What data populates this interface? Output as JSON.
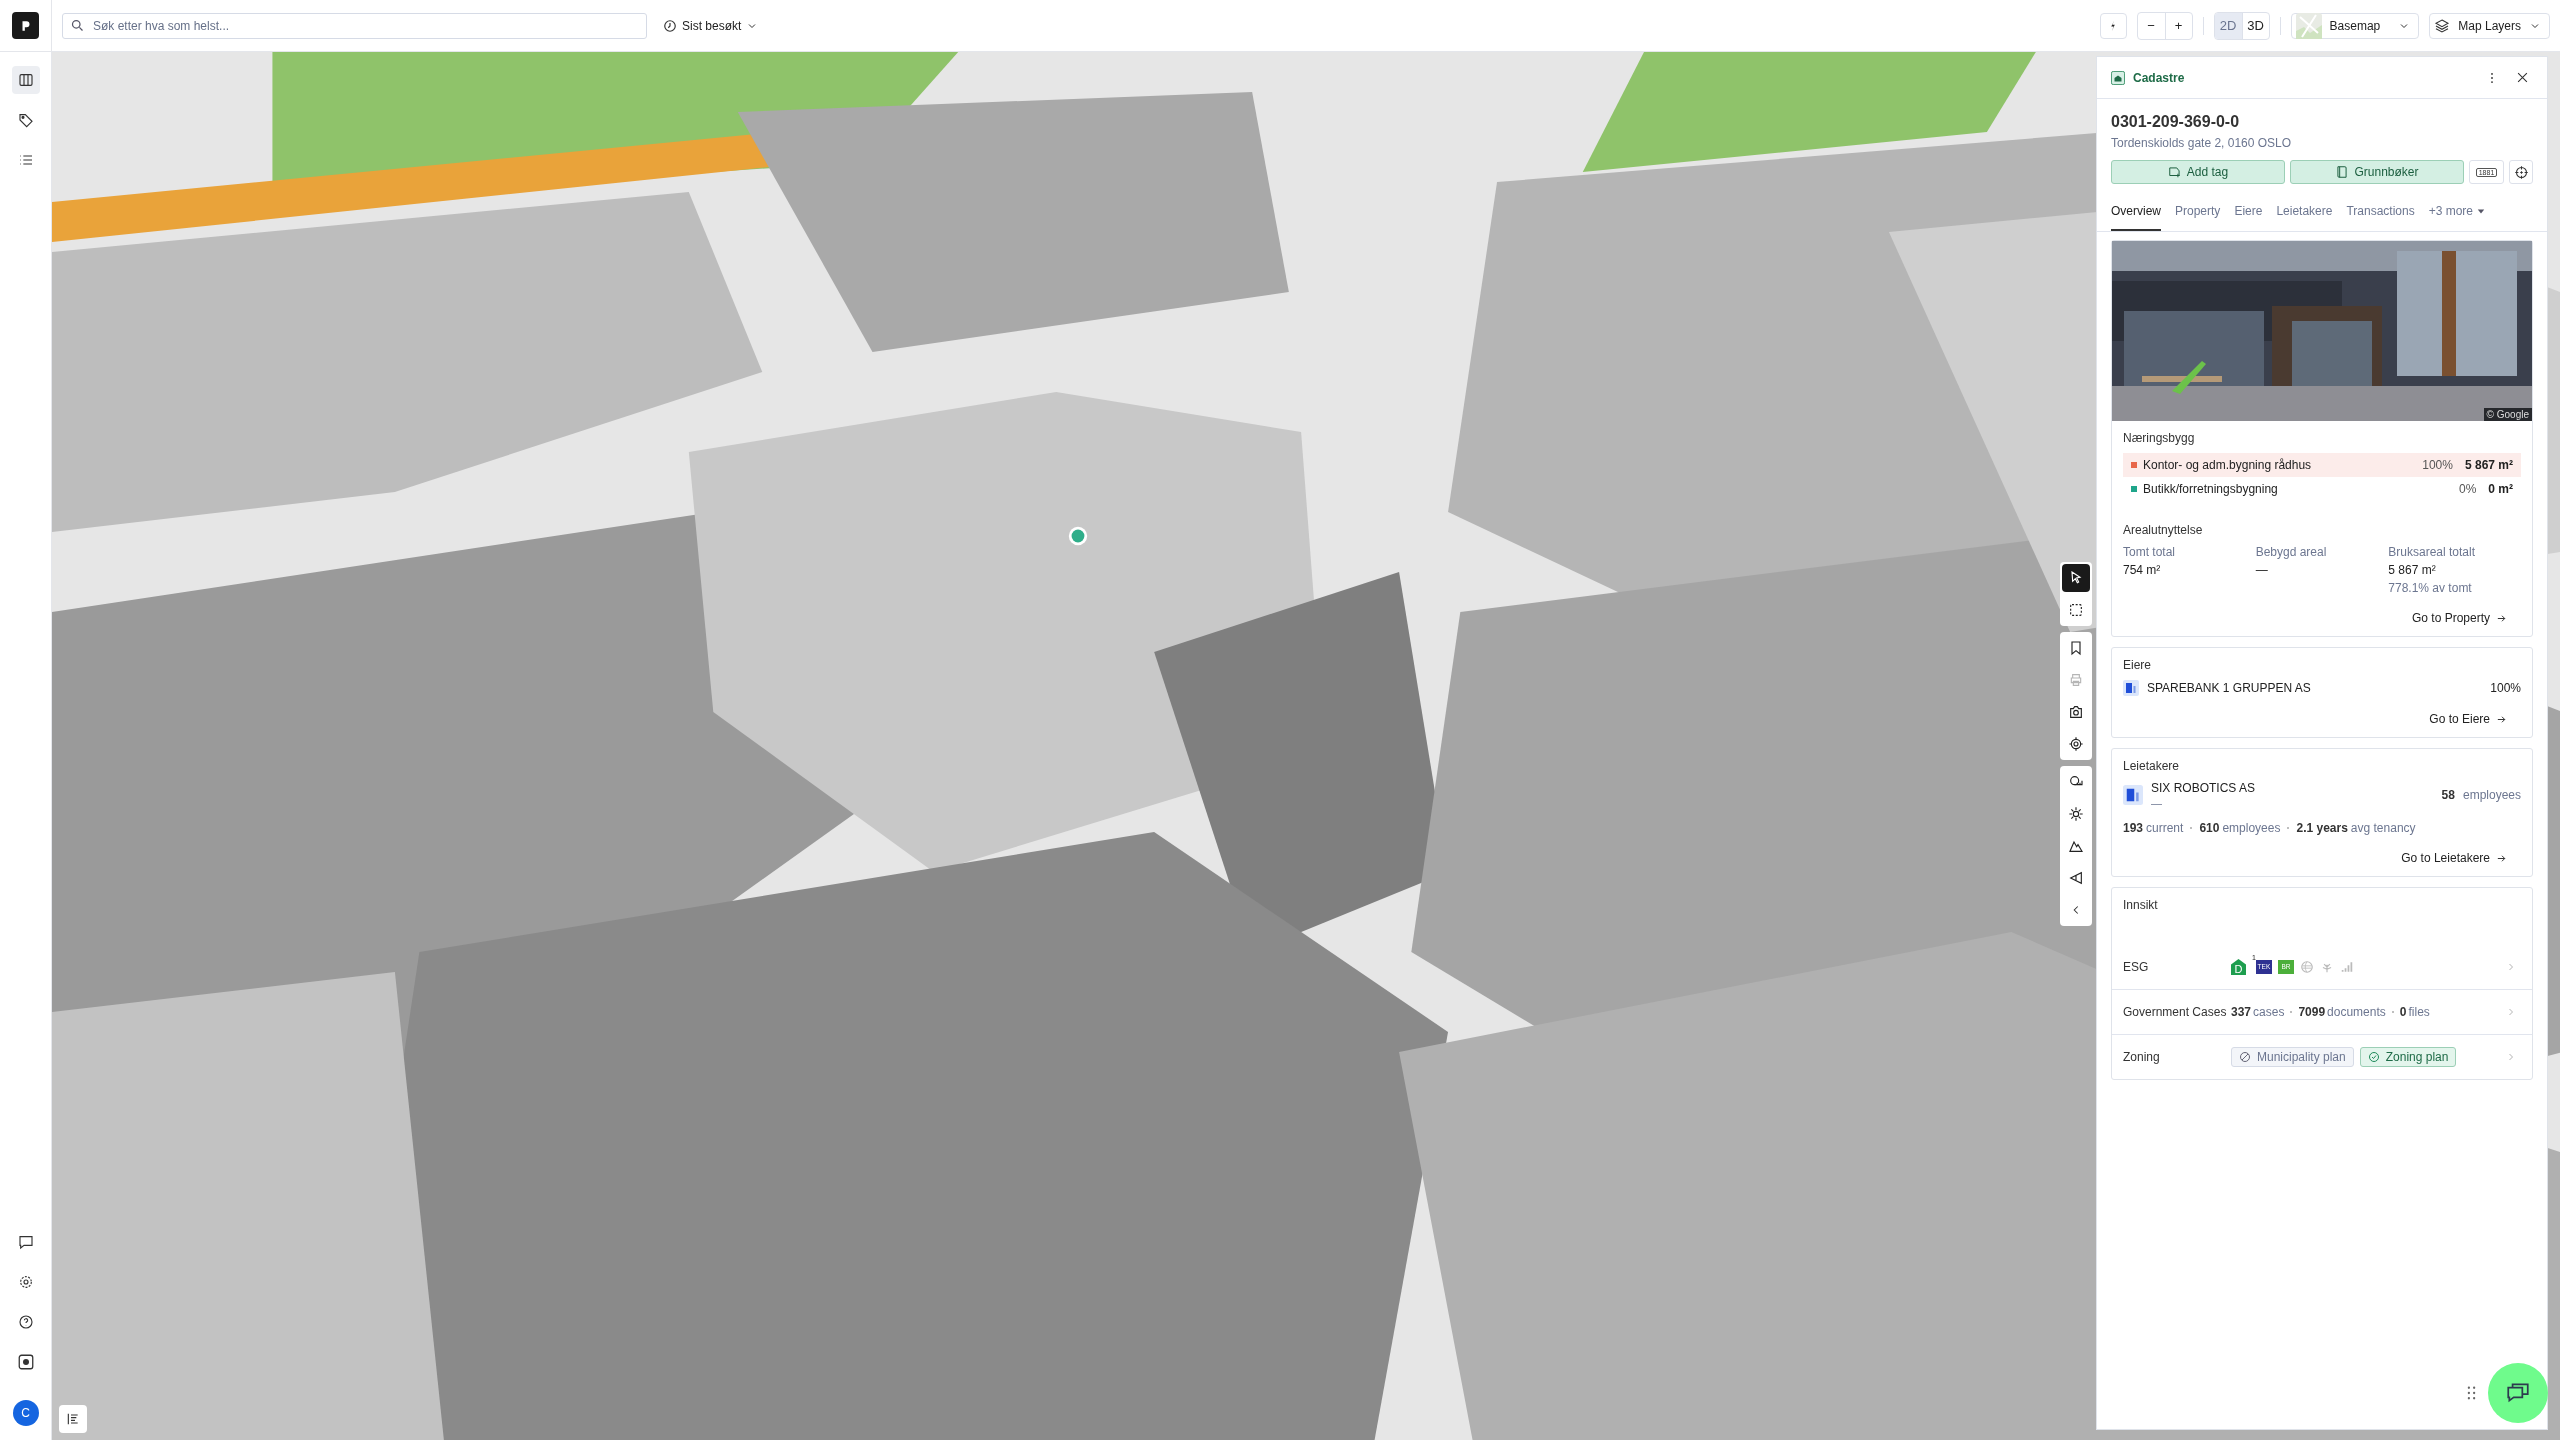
{
  "top_bar": {
    "search": {
      "placeholder": "Søk etter hva som helst..."
    },
    "recent": "Sist besøkt",
    "zoom_out": "−",
    "zoom_in": "+",
    "view_modes": [
      {
        "label": "2D",
        "selected": true
      },
      {
        "label": "3D",
        "selected": false
      }
    ],
    "basemap": "Basemap",
    "map_layers": "Map Layers"
  },
  "sidebar": {
    "nav": [
      {
        "selected": true
      },
      {
        "selected": false
      },
      {
        "selected": false
      }
    ],
    "avatar": "C"
  },
  "map_tools": [
    {
      "selected": true,
      "disabled": false
    },
    {
      "selected": false,
      "disabled": false
    },
    {
      "selected": false,
      "disabled": false
    },
    {
      "selected": false,
      "disabled": true
    },
    {
      "selected": false,
      "disabled": false
    },
    {
      "selected": false,
      "disabled": false
    },
    {
      "selected": false,
      "disabled": false
    },
    {
      "selected": false,
      "disabled": false
    },
    {
      "selected": false,
      "disabled": false
    },
    {
      "selected": false,
      "disabled": false
    }
  ],
  "panel": {
    "category": "Cadastre",
    "id": "0301-209-369-0-0",
    "address": "Tordenskiolds gate 2, 0160 OSLO",
    "actions": [
      "Add tag",
      "Grunnbøker"
    ],
    "registry_badge": "1881",
    "tabs": [
      {
        "label": "Overview",
        "selected": true
      },
      {
        "label": "Property",
        "selected": false
      },
      {
        "label": "Eiere",
        "selected": false
      },
      {
        "label": "Leietakere",
        "selected": false
      },
      {
        "label": "Transactions",
        "selected": false
      },
      {
        "label": "+3 more",
        "selected": false
      }
    ],
    "photo_attribution": "© Google",
    "building": {
      "title": "Næringsbygg",
      "uses": [
        {
          "name": "Kontor- og adm.bygning rådhus",
          "share": "100%",
          "area": "5 867 m²",
          "color": "#e8674a",
          "selected": true
        },
        {
          "name": "Butikk/forretningsbygning",
          "share": "0%",
          "area": "0 m²",
          "color": "#1fa58a",
          "selected": false
        }
      ]
    },
    "utilization": {
      "title": "Arealutnyttelse",
      "stats": [
        {
          "label": "Tomt total",
          "value": "754 m²"
        },
        {
          "label": "Bebygd areal",
          "value": "—"
        },
        {
          "label": "Bruksareal totalt",
          "value": "5 867 m²",
          "note": "778.1% av tomt"
        }
      ],
      "link": "Go to Property"
    },
    "owners": {
      "title": "Eiere",
      "items": [
        {
          "name": "SPAREBANK 1 GRUPPEN AS",
          "share": "100%"
        }
      ],
      "link": "Go to Eiere"
    },
    "tenants": {
      "title": "Leietakere",
      "items": [
        {
          "name": "SIX ROBOTICS AS",
          "sub": "—",
          "count": "58",
          "unit": "employees"
        }
      ],
      "stats": [
        {
          "value": "193",
          "unit": "current"
        },
        {
          "value": "610",
          "unit": "employees"
        },
        {
          "value": "2.1 years",
          "unit": "avg tenancy"
        }
      ],
      "link": "Go to Leietakere"
    },
    "insight": {
      "title": "Innsikt",
      "esg": {
        "label": "ESG",
        "labels": [
          {
            "text": "D",
            "kind": "house",
            "color": "#1e9e4f"
          },
          {
            "text": "TEK",
            "kind": "square",
            "color": "#2e3192",
            "note": "1"
          },
          {
            "text": "BR",
            "kind": "square",
            "color": "#4caf3a"
          }
        ]
      },
      "cases": {
        "label": "Government Cases",
        "stats": [
          {
            "value": "337",
            "unit": "cases"
          },
          {
            "value": "7099",
            "unit": "documents"
          },
          {
            "value": "0",
            "unit": "files"
          }
        ]
      },
      "zoning": {
        "label": "Zoning",
        "plans": [
          {
            "label": "Municipality plan",
            "on": false
          },
          {
            "label": "Zoning plan",
            "on": true
          }
        ]
      }
    }
  }
}
